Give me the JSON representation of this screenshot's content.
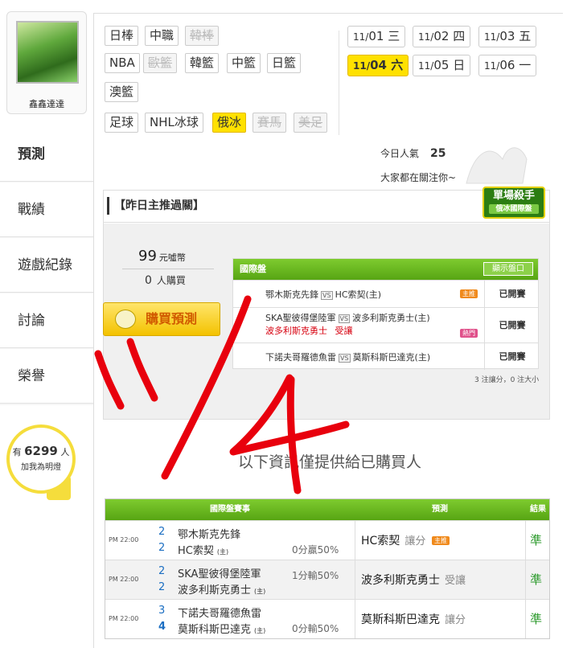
{
  "user": {
    "name": "鑫鑫達達"
  },
  "nav": [
    {
      "label": "預測"
    },
    {
      "label": "戰績"
    },
    {
      "label": "遊戲紀錄"
    },
    {
      "label": "討論"
    },
    {
      "label": "榮譽"
    }
  ],
  "fans": {
    "prefix": "有",
    "count": "6299",
    "suffix": "人",
    "cta": "加我為明燈"
  },
  "sports": [
    {
      "label": "日棒",
      "state": "normal"
    },
    {
      "label": "中職",
      "state": "normal"
    },
    {
      "label": "韓棒",
      "state": "disabled"
    },
    {
      "label": "NBA",
      "state": "normal"
    },
    {
      "label": "歐籃",
      "state": "disabled"
    },
    {
      "label": "韓籃",
      "state": "normal"
    },
    {
      "label": "中籃",
      "state": "normal"
    },
    {
      "label": "日籃",
      "state": "normal"
    },
    {
      "label": "澳籃",
      "state": "normal"
    },
    {
      "label": "足球",
      "state": "normal"
    },
    {
      "label": "NHL冰球",
      "state": "normal"
    },
    {
      "label": "俄冰",
      "state": "selected"
    },
    {
      "label": "賽馬",
      "state": "disabled"
    },
    {
      "label": "美足",
      "state": "disabled"
    }
  ],
  "dates": [
    {
      "month": "11/",
      "day": "01",
      "weekday": "三"
    },
    {
      "month": "11/",
      "day": "02",
      "weekday": "四"
    },
    {
      "month": "11/",
      "day": "03",
      "weekday": "五"
    },
    {
      "month": "11/",
      "day": "04",
      "weekday": "六",
      "selected": true
    },
    {
      "month": "11/",
      "day": "05",
      "weekday": "日"
    },
    {
      "month": "11/",
      "day": "06",
      "weekday": "一"
    }
  ],
  "popularity": {
    "label": "今日人氣",
    "value": "25",
    "attention": "大家都在關注你~"
  },
  "yesterday": {
    "title": "【昨日主推過關】",
    "badge_title": "單場殺手",
    "badge_sub": "俄冰國際盤"
  },
  "purchase": {
    "price": "99",
    "unit": "元噓幣",
    "buyers": "0",
    "buyers_label": "人購買",
    "button": "購買預測"
  },
  "intl": {
    "header": "國際盤",
    "show_button": "顯示盤口",
    "vs": "VS",
    "rows": [
      {
        "away": "鄂木斯克先鋒",
        "home": "HC索契(主)",
        "pick": "",
        "tag": "主推",
        "status": "已開賽"
      },
      {
        "away": "SKA聖彼得堡陸軍",
        "home": "波多利斯克勇士(主)",
        "pick": "波多利斯克勇士",
        "pick_type": "受讓",
        "tag": "熱門",
        "status": "已開賽"
      },
      {
        "away": "下諾夫哥羅德魚雷",
        "home": "莫斯科斯巴達克(主)",
        "pick": "",
        "tag": "",
        "status": "已開賽"
      }
    ],
    "summary": "3 注讓分，0 注大小"
  },
  "info_text": "以下資訊僅提供給已購買人",
  "results": {
    "headers": [
      "國際盤賽事",
      "預測",
      "結果"
    ],
    "rows": [
      {
        "time": "PM 22:00",
        "away_score": "2",
        "away": "鄂木斯克先鋒",
        "home_score": "2",
        "home": "HC索契",
        "home_tag": "(主)",
        "odds": "0分贏50%",
        "pred": "HC索契",
        "pred_type": "讓分",
        "pred_tag": "主推",
        "result": "準"
      },
      {
        "time": "PM 22:00",
        "away_score": "2",
        "away": "SKA聖彼得堡陸軍",
        "home_score": "2",
        "home": "波多利斯克勇士",
        "home_tag": "(主)",
        "odds": "1分輸50%",
        "pred": "波多利斯克勇士",
        "pred_type": "受讓",
        "pred_tag": "",
        "result": "準"
      },
      {
        "time": "PM 22:00",
        "away_score": "3",
        "away": "下諾夫哥羅德魚雷",
        "home_score": "4",
        "home": "莫斯科斯巴達克",
        "home_tag": "(主)",
        "odds": "0分輸50%",
        "pred": "莫斯科斯巴達克",
        "pred_type": "讓分",
        "pred_tag": "",
        "result": "準"
      }
    ]
  },
  "colors": {
    "accent_green": "#6abf26",
    "highlight_yellow": "#ffe100",
    "annotation_red": "#e8000d"
  }
}
